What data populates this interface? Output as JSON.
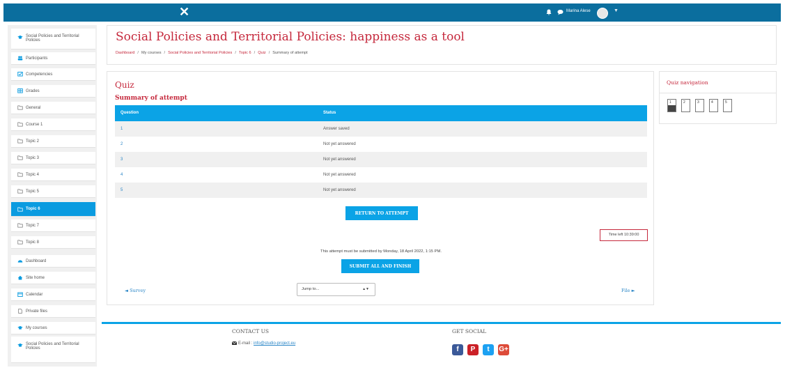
{
  "topbar": {
    "username": "Marina Alese"
  },
  "sidebar": {
    "items": [
      {
        "label": "Social Policies and Territorial Policies",
        "icon": "graduation-cap-icon"
      },
      {
        "label": "Participants",
        "icon": "users-icon"
      },
      {
        "label": "Competencies",
        "icon": "check-square-icon"
      },
      {
        "label": "Grades",
        "icon": "table-icon"
      },
      {
        "label": "General",
        "icon": "folder-icon"
      },
      {
        "label": "Course 1",
        "icon": "folder-icon"
      },
      {
        "label": "Topic 2",
        "icon": "folder-icon"
      },
      {
        "label": "Topic 3",
        "icon": "folder-icon"
      },
      {
        "label": "Topic 4",
        "icon": "folder-icon"
      },
      {
        "label": "Topic 5",
        "icon": "folder-icon"
      },
      {
        "label": "Topic 6",
        "icon": "folder-icon",
        "active": true
      },
      {
        "label": "Topic 7",
        "icon": "folder-icon"
      },
      {
        "label": "Topic 8",
        "icon": "folder-icon"
      },
      {
        "label": "Dashboard",
        "icon": "dashboard-icon"
      },
      {
        "label": "Site home",
        "icon": "home-icon"
      },
      {
        "label": "Calendar",
        "icon": "calendar-icon"
      },
      {
        "label": "Private files",
        "icon": "file-icon"
      },
      {
        "label": "My courses",
        "icon": "graduation-cap-icon"
      },
      {
        "label": "Social Policies and Territorial Policies",
        "icon": "graduation-cap-icon"
      }
    ]
  },
  "header": {
    "title": "Social Policies and Territorial Policies: happiness as a tool",
    "breadcrumb": [
      "Dashboard",
      "My courses",
      "Social Policies and Territorial Policies",
      "Topic 6",
      "Quiz",
      "Summary of attempt"
    ]
  },
  "main": {
    "quiz_title": "Quiz",
    "summary_title": "Summary of attempt",
    "table": {
      "headers": [
        "Question",
        "Status"
      ],
      "rows": [
        {
          "question": "1",
          "status": "Answer saved"
        },
        {
          "question": "2",
          "status": "Not yet answered"
        },
        {
          "question": "3",
          "status": "Not yet answered"
        },
        {
          "question": "4",
          "status": "Not yet answered"
        },
        {
          "question": "5",
          "status": "Not yet answered"
        }
      ]
    },
    "return_button": "RETURN TO ATTEMPT",
    "time_left": "Time left 10:39:00",
    "submit_note": "This attempt must be submitted by Monday, 18 April 2022, 1:15 PM.",
    "submit_button": "SUBMIT ALL AND FINISH",
    "prev_link": "◄ Survey",
    "next_link": "File ►",
    "jump_placeholder": "Jump to..."
  },
  "quiz_navigation": {
    "title": "Quiz navigation",
    "questions": [
      {
        "number": "1",
        "answered": true
      },
      {
        "number": "2",
        "answered": false
      },
      {
        "number": "3",
        "answered": false
      },
      {
        "number": "4",
        "answered": false
      },
      {
        "number": "5",
        "answered": false
      }
    ]
  },
  "footer": {
    "contact_title": "CONTACT US",
    "email_label": "E-mail :",
    "email": "info@studio-project.eu",
    "social_title": "GET SOCIAL",
    "social": [
      {
        "name": "facebook-icon",
        "glyph": "f",
        "color": "#3b5998"
      },
      {
        "name": "pinterest-icon",
        "glyph": "P",
        "color": "#cb2027"
      },
      {
        "name": "twitter-icon",
        "glyph": "t",
        "color": "#1da1f2"
      },
      {
        "name": "google-plus-icon",
        "glyph": "G+",
        "color": "#dd4b39"
      }
    ]
  },
  "colors": {
    "topbar": "#0b6e9e",
    "accent": "#0ba3e6",
    "title_red": "#c5283c"
  }
}
